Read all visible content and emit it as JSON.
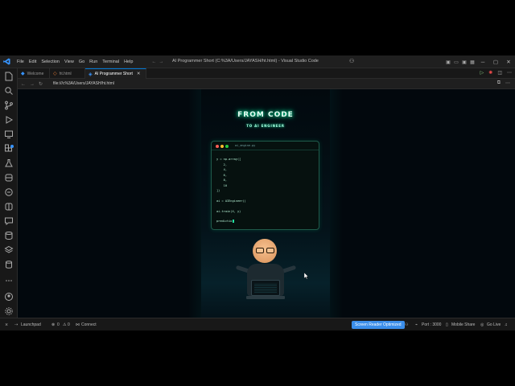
{
  "window": {
    "title": "AI Programmer Short (C:%3A/Users/JAYASH/ht.html) - Visual Studio Code",
    "menu": [
      "File",
      "Edit",
      "Selection",
      "View",
      "Go",
      "Run",
      "Terminal",
      "Help"
    ]
  },
  "tabs": [
    {
      "label": "Welcome",
      "active": false
    },
    {
      "label": "ht.html",
      "active": false
    },
    {
      "label": "AI Programmer Short",
      "active": true
    }
  ],
  "address": {
    "url": "file:///c%3A/Users/JAYASH/ht.html"
  },
  "page": {
    "title": "FROM CODE",
    "subtitle": "TO AI ENGINEER",
    "code_card": {
      "filename": "ai_engine.py",
      "lines": [
        "y = np.array([",
        "    2,",
        "    4,",
        "    6,",
        "    8,",
        "    10",
        "])",
        "",
        "ai = AIEngineer()",
        "",
        "ai.train(X, y)",
        "",
        "predictio"
      ]
    }
  },
  "statusbar": {
    "launchpad": "Launchpad",
    "errors": "0",
    "warnings": "0",
    "connect": "Connect",
    "screen_reader": "Screen Reader Optimized",
    "port": "Port : 3000",
    "mobile_share": "Mobile Share",
    "go_live": "Go Live"
  },
  "colors": {
    "accent": "#0078d4",
    "neon": "#00ffb0",
    "status_badge": "#3b8eea"
  }
}
